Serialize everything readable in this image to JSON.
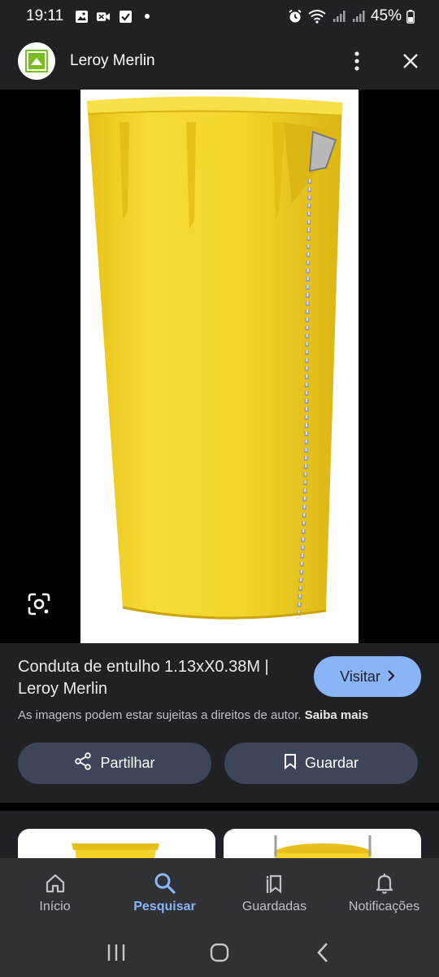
{
  "status_bar": {
    "time": "19:11",
    "battery": "45%"
  },
  "header": {
    "site_name": "Leroy Merlin",
    "brand_color": "#78be20"
  },
  "result": {
    "title": "Conduta de entulho 1.13xX0.38M | Leroy Merlin",
    "visit_label": "Visitar",
    "copyright_notice": "As imagens podem estar sujeitas a direitos de autor.",
    "learn_more": "Saiba mais",
    "share_label": "Partilhar",
    "save_label": "Guardar"
  },
  "bottom_nav": {
    "items": [
      {
        "label": "Início",
        "icon": "home-icon"
      },
      {
        "label": "Pesquisar",
        "icon": "search-icon",
        "active": true
      },
      {
        "label": "Guardadas",
        "icon": "bookmarks-icon"
      },
      {
        "label": "Notificações",
        "icon": "bell-icon"
      }
    ]
  },
  "colors": {
    "accent": "#8ab4f8",
    "panel": "#202124",
    "button": "#3c4658",
    "product": "#f5d52b"
  }
}
